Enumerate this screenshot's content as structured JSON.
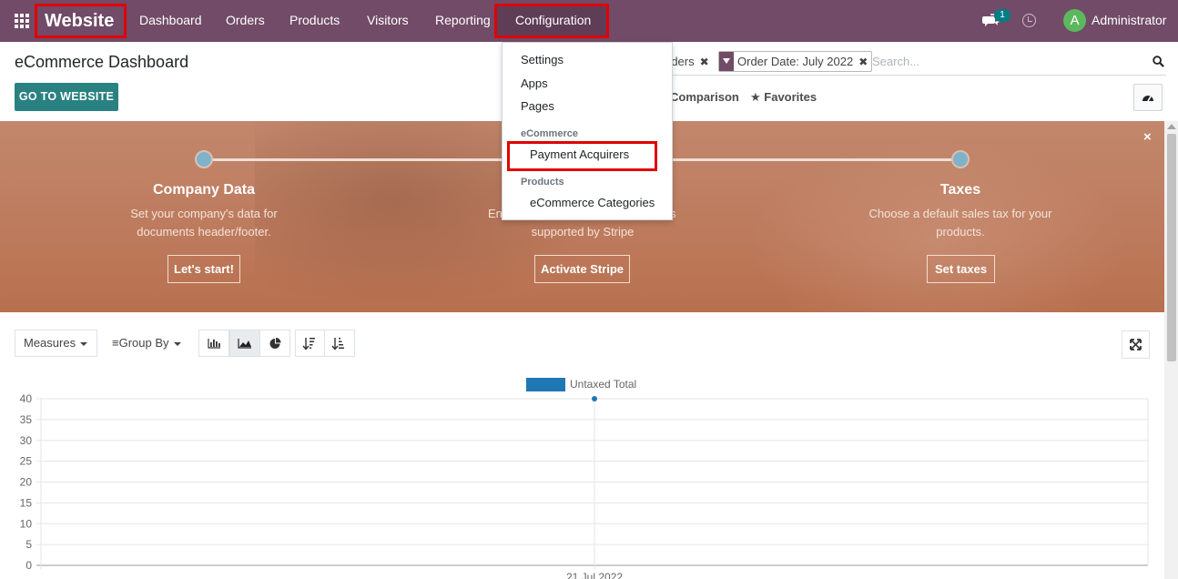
{
  "navbar": {
    "brand": "Website",
    "menu": [
      "Dashboard",
      "Orders",
      "Products",
      "Visitors",
      "Reporting",
      "Configuration"
    ],
    "notification_count": "1",
    "avatar_letter": "A",
    "user": "Administrator",
    "color": "#714B67"
  },
  "control_panel": {
    "title": "eCommerce Dashboard",
    "go_button": "GO TO WEBSITE",
    "facet_partial": "rders",
    "facet_date": "Order Date: July 2022",
    "search_placeholder": "Search...",
    "comparison_label": "Comparison",
    "favorites_label": "Favorites"
  },
  "banner": {
    "close": "×",
    "steps": [
      {
        "title": "Company Data",
        "desc": [
          "Set your company's data for",
          "documents header/footer."
        ],
        "button": "Let's start!"
      },
      {
        "title": "",
        "desc": [
          "En",
          "s",
          "supported by Stripe"
        ],
        "button": "Activate Stripe"
      },
      {
        "title": "Taxes",
        "desc": [
          "Choose a default sales tax for your",
          "products."
        ],
        "button": "Set taxes"
      }
    ]
  },
  "graph_controls": {
    "measures": "Measures",
    "group_by": "Group By",
    "view_icons": [
      "bar-chart-icon",
      "area-chart-icon",
      "pie-chart-icon"
    ],
    "sort_icons": [
      "sort-descending-icon",
      "sort-ascending-icon"
    ]
  },
  "dropdown": {
    "items": [
      "Settings",
      "Apps",
      "Pages"
    ],
    "section_ecommerce": "eCommerce",
    "payment_acquirers": "Payment Acquirers",
    "section_products": "Products",
    "ecommerce_categories": "eCommerce Categories"
  },
  "chart_data": {
    "type": "line",
    "legend": [
      "Untaxed Total"
    ],
    "series": [
      {
        "name": "Untaxed Total",
        "values": [
          40
        ]
      }
    ],
    "x": [
      "21 Jul 2022"
    ],
    "y_ticks": [
      0,
      5,
      10,
      15,
      20,
      25,
      30,
      35,
      40
    ],
    "ylim": [
      0,
      40
    ],
    "series_color": "#1f77b4",
    "grid": true,
    "legend_position": "top-center"
  }
}
